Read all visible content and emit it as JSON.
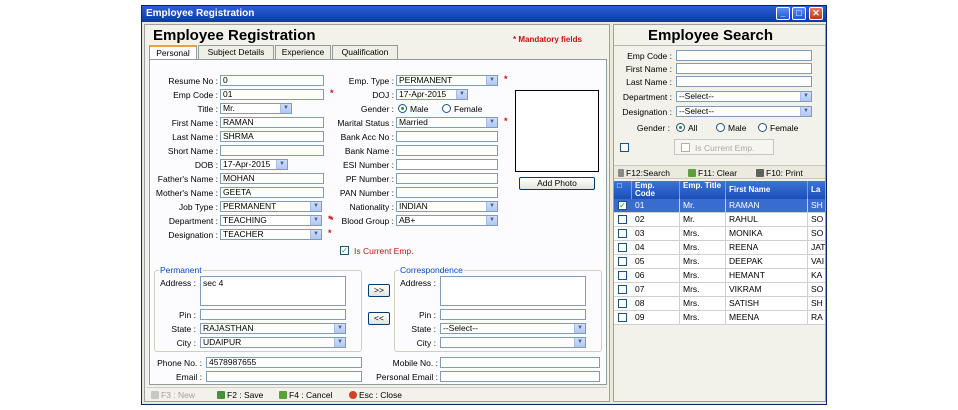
{
  "window": {
    "title": "Employee Registration"
  },
  "registration": {
    "heading": "Employee Registration",
    "mandatory_note": "* Mandatory  fields",
    "tabs": [
      "Personal",
      "Subject Details",
      "Experience",
      "Qualification"
    ],
    "fields": {
      "resume_no": {
        "label": "Resume No :",
        "value": "0"
      },
      "emp_code": {
        "label": "Emp Code :",
        "value": "01"
      },
      "title": {
        "label": "Title :",
        "value": "Mr."
      },
      "first_name": {
        "label": "First Name :",
        "value": "RAMAN"
      },
      "last_name": {
        "label": "Last Name :",
        "value": "SHRMA"
      },
      "short_name": {
        "label": "Short Name :",
        "value": ""
      },
      "dob": {
        "label": "DOB :",
        "value": "17-Apr-2015"
      },
      "fathers_name": {
        "label": "Father's Name :",
        "value": "MOHAN"
      },
      "mothers_name": {
        "label": "Mother's Name :",
        "value": "GEETA"
      },
      "job_type": {
        "label": "Job Type :",
        "value": "PERMANENT"
      },
      "department": {
        "label": "Department :",
        "value": "TEACHING"
      },
      "designation": {
        "label": "Designation :",
        "value": "TEACHER"
      },
      "emp_type": {
        "label": "Emp. Type :",
        "value": "PERMANENT"
      },
      "doj": {
        "label": "DOJ :",
        "value": "17-Apr-2015"
      },
      "gender": {
        "label": "Gender :",
        "options": [
          "Male",
          "Female"
        ]
      },
      "marital_status": {
        "label": "Marital Status :",
        "value": "Married"
      },
      "bank_acc_no": {
        "label": "Bank Acc No :",
        "value": ""
      },
      "bank_name": {
        "label": "Bank Name :",
        "value": ""
      },
      "esi_number": {
        "label": "ESI Number :",
        "value": ""
      },
      "pf_number": {
        "label": "PF Number :",
        "value": ""
      },
      "pan_number": {
        "label": "PAN Number :",
        "value": ""
      },
      "nationality": {
        "label": "Nationality :",
        "value": "INDIAN"
      },
      "blood_group": {
        "label": "Blood Group :",
        "value": "AB+"
      }
    },
    "is_current_emp": "Is Current Emp.",
    "add_photo": "Add Photo",
    "permanent": {
      "title": "Permanent",
      "address_label": "Address :",
      "address": "sec 4",
      "pin_label": "Pin :",
      "state_label": "State :",
      "state": "RAJASTHAN",
      "city_label": "City :",
      "city": "UDAIPUR"
    },
    "correspondence": {
      "title": "Correspondence",
      "address_label": "Address :",
      "pin_label": "Pin :",
      "state_label": "State :",
      "state": "--Select--",
      "city_label": "City :",
      "city": ""
    },
    "copy_right": ">>",
    "copy_left": "<<",
    "phone": {
      "label": "Phone No. :",
      "value": "4578987655"
    },
    "email": {
      "label": "Email :",
      "value": ""
    },
    "mobile": {
      "label": "Mobile No. :",
      "value": ""
    },
    "personal_email": {
      "label": "Personal Email :",
      "value": ""
    },
    "bottom": {
      "new": "F3 : New",
      "save": "F2 : Save",
      "cancel": "F4 : Cancel",
      "close": "Esc : Close"
    }
  },
  "search": {
    "heading": "Employee Search",
    "emp_code_label": "Emp Code :",
    "first_name_label": "First Name :",
    "last_name_label": "Last Name :",
    "department_label": "Department :",
    "department": "--Select--",
    "designation_label": "Designation :",
    "designation": "--Select--",
    "gender_label": "Gender :",
    "gender_options": [
      "All",
      "Male",
      "Female"
    ],
    "is_current_emp": "Is Current Emp.",
    "toolbar": {
      "search": "F12:Search",
      "clear": "F11: Clear",
      "print": "F10: Print"
    },
    "columns": [
      "Emp. Code",
      "Emp. Title",
      "First Name",
      "La"
    ],
    "rows": [
      {
        "code": "01",
        "title": "Mr.",
        "first": "RAMAN",
        "last": "SH"
      },
      {
        "code": "02",
        "title": "Mr.",
        "first": "RAHUL",
        "last": "SO"
      },
      {
        "code": "03",
        "title": "Mrs.",
        "first": "MONIKA",
        "last": "SO"
      },
      {
        "code": "04",
        "title": "Mrs.",
        "first": "REENA",
        "last": "JAT"
      },
      {
        "code": "05",
        "title": "Mrs.",
        "first": "DEEPAK",
        "last": "VAI"
      },
      {
        "code": "06",
        "title": "Mrs.",
        "first": "HEMANT",
        "last": "KA"
      },
      {
        "code": "07",
        "title": "Mrs.",
        "first": "VIKRAM",
        "last": "SO"
      },
      {
        "code": "08",
        "title": "Mrs.",
        "first": "SATISH",
        "last": "SH"
      },
      {
        "code": "09",
        "title": "Mrs.",
        "first": "MEENA",
        "last": "RA"
      }
    ]
  }
}
